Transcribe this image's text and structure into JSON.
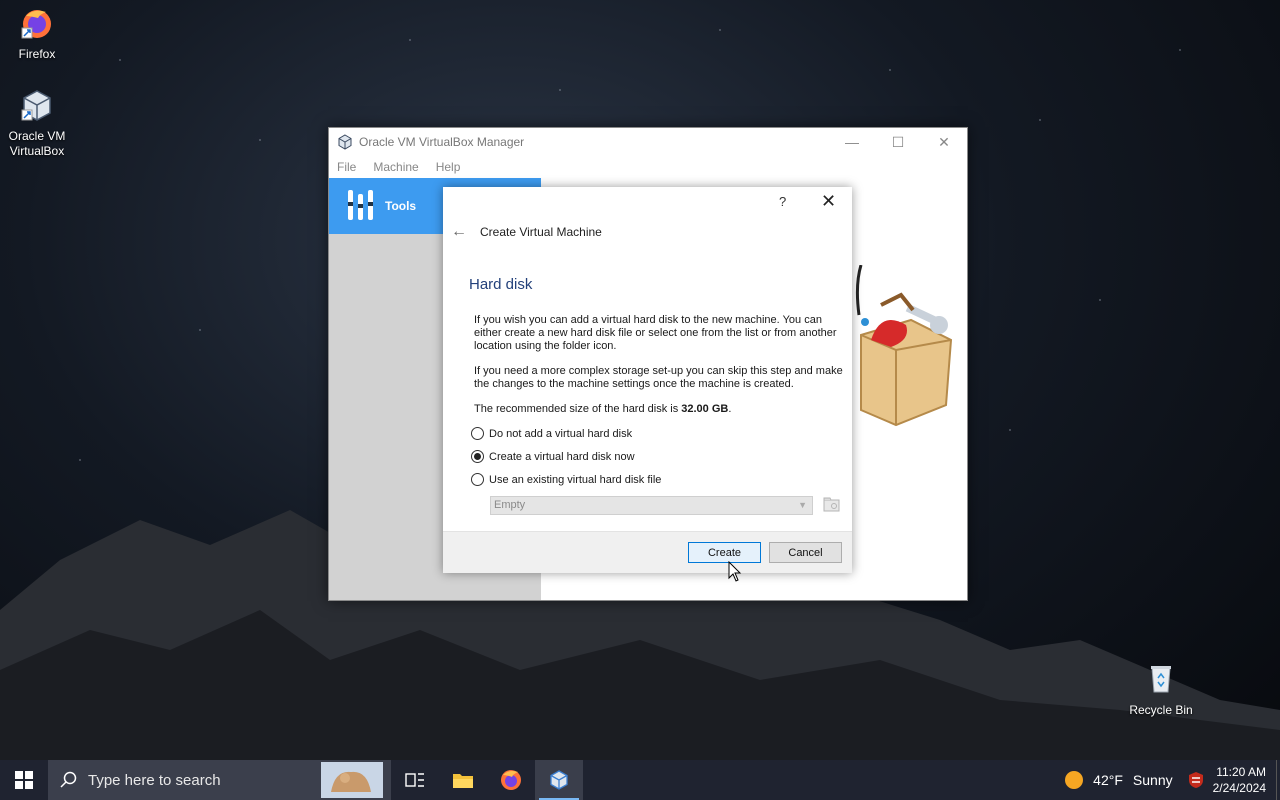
{
  "desktop": {
    "icons": [
      {
        "label": "Firefox",
        "icon": "firefox-icon"
      },
      {
        "label": "Oracle VM VirtualBox",
        "icon": "virtualbox-icon"
      },
      {
        "label": "Recycle Bin",
        "icon": "recycle-bin-icon"
      }
    ]
  },
  "window": {
    "title": "Oracle VM VirtualBox Manager",
    "menu": [
      "File",
      "Machine",
      "Help"
    ],
    "sidebar": {
      "tools_label": "Tools"
    }
  },
  "dialog": {
    "help_label": "?",
    "title": "Create Virtual Machine",
    "section_title": "Hard disk",
    "paragraph1": "If you wish you can add a virtual hard disk to the new machine. You can either create a new hard disk file or select one from the list or from another location using the folder icon.",
    "paragraph2": "If you need a more complex storage set-up you can skip this step and make the changes to the machine settings once the machine is created.",
    "recommended_prefix": "The recommended size of the hard disk is ",
    "recommended_size": "32.00 GB",
    "recommended_suffix": ".",
    "options": [
      {
        "label": "Do not add a virtual hard disk",
        "checked": false
      },
      {
        "label": "Create a virtual hard disk now",
        "checked": true
      },
      {
        "label": "Use an existing virtual hard disk file",
        "checked": false
      }
    ],
    "disk_select_value": "Empty",
    "buttons": {
      "create": "Create",
      "cancel": "Cancel"
    }
  },
  "taskbar": {
    "search_placeholder": "Type here to search",
    "weather": {
      "temp": "42°F",
      "condition": "Sunny"
    },
    "clock": {
      "time": "11:20 AM",
      "date": "2/24/2024"
    }
  }
}
